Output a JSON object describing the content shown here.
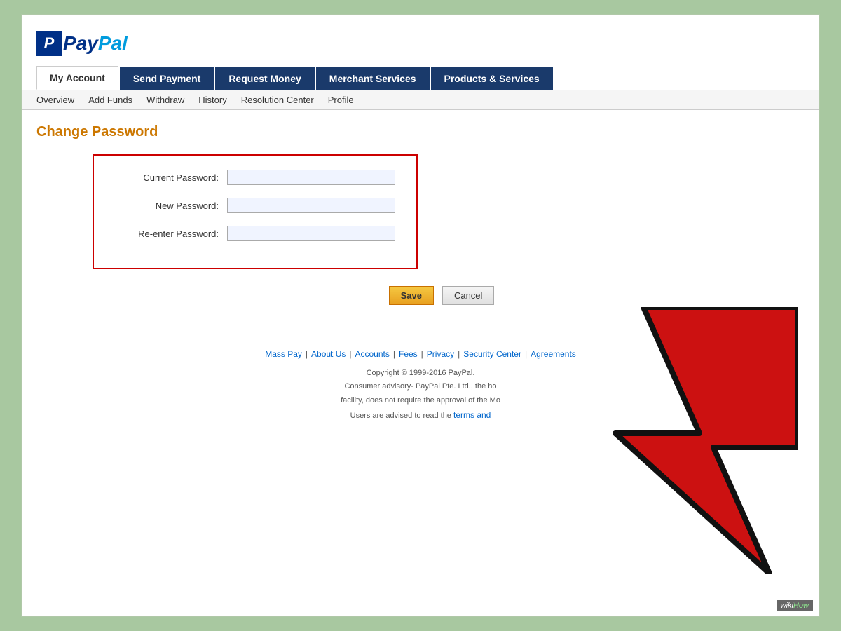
{
  "logo": {
    "p_letter": "P",
    "pay": "Pay",
    "pal": "Pal"
  },
  "nav": {
    "tabs": [
      {
        "label": "My Account",
        "active": true,
        "style": "active"
      },
      {
        "label": "Send Payment",
        "active": false,
        "style": "dark"
      },
      {
        "label": "Request Money",
        "active": false,
        "style": "dark"
      },
      {
        "label": "Merchant Services",
        "active": false,
        "style": "dark"
      },
      {
        "label": "Products & Services",
        "active": false,
        "style": "dark"
      }
    ],
    "subnav": [
      {
        "label": "Overview"
      },
      {
        "label": "Add Funds"
      },
      {
        "label": "Withdraw"
      },
      {
        "label": "History"
      },
      {
        "label": "Resolution Center"
      },
      {
        "label": "Profile"
      }
    ]
  },
  "page": {
    "title": "Change Password"
  },
  "form": {
    "current_password_label": "Current Password:",
    "new_password_label": "New Password:",
    "reenter_password_label": "Re-enter Password:",
    "save_button": "Save",
    "cancel_button": "Cancel"
  },
  "footer": {
    "links": [
      {
        "label": "Mass Pay"
      },
      {
        "label": "About Us"
      },
      {
        "label": "Accounts"
      },
      {
        "label": "Fees"
      },
      {
        "label": "Privacy"
      },
      {
        "label": "Security Center"
      },
      {
        "label": "Agreements"
      }
    ],
    "copyright": "Copyright © 1999-2016 PayPal.",
    "advisory1": "Consumer advisory- PayPal Pte. Ltd., the ho",
    "advisory2": "facility, does not require the approval of the Mo",
    "advisory3": "Users are advised to read the",
    "terms_link": "terms and",
    "suffix": ""
  },
  "wikihow_badge": "wikiHow"
}
